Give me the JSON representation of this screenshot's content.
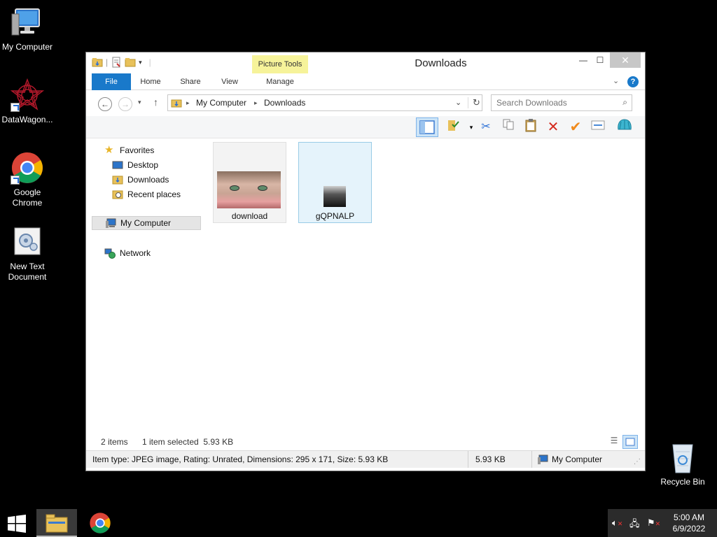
{
  "desktop": {
    "icons": [
      {
        "label": "My Computer"
      },
      {
        "label": "DataWagon..."
      },
      {
        "label": "Google\nChrome"
      },
      {
        "label": "New Text\nDocument"
      },
      {
        "label": "Recycle Bin"
      }
    ]
  },
  "window": {
    "title": "Downloads",
    "contextual_tab_group": "Picture Tools",
    "tabs": [
      "File",
      "Home",
      "Share",
      "View",
      "Manage"
    ],
    "address": {
      "segments": [
        "My Computer",
        "Downloads"
      ]
    },
    "search": {
      "placeholder": "Search Downloads"
    },
    "nav_pane": {
      "favorites": "Favorites",
      "favorites_items": [
        "Desktop",
        "Downloads",
        "Recent places"
      ],
      "computer": "My Computer",
      "network": "Network"
    },
    "files": [
      {
        "name": "download",
        "selected": false
      },
      {
        "name": "gQPNALP",
        "selected": true
      }
    ],
    "status": {
      "items": "2 items",
      "selection": "1 item selected  5.93 KB"
    },
    "details": {
      "info": "Item type: JPEG image, Rating: Unrated, Dimensions: 295 x 171, Size: 5.93 KB",
      "size": "5.93 KB",
      "location": "My Computer"
    }
  },
  "taskbar": {
    "time": "5:00 AM",
    "date": "6/9/2022"
  },
  "colors": {
    "accent": "#1979ca",
    "picture_tools": "#f6f39a",
    "selection": "#e5f3fb"
  }
}
